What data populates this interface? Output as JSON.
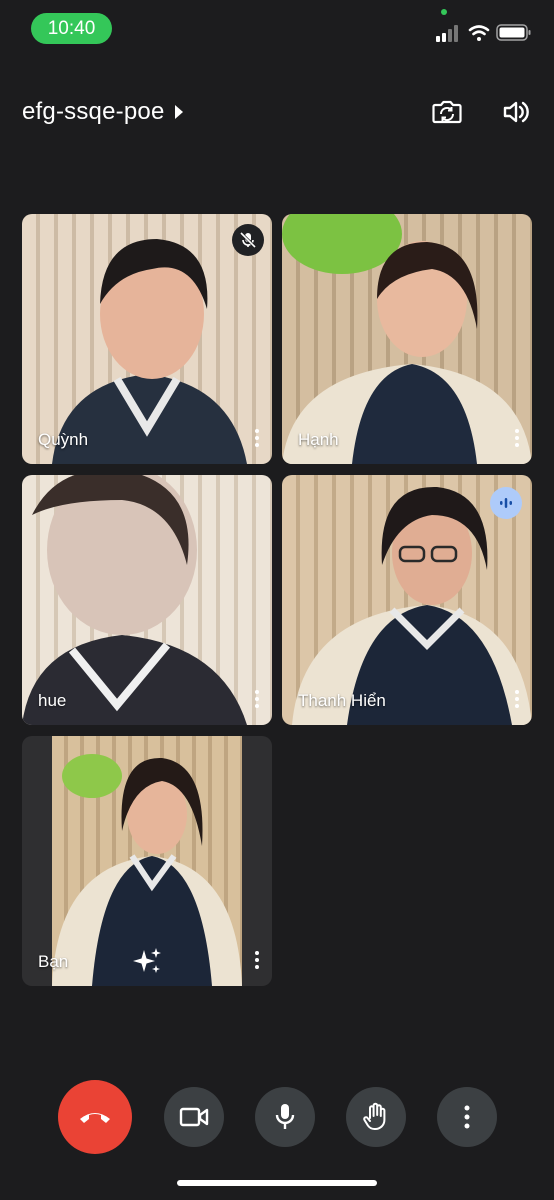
{
  "status_bar": {
    "time": "10:40"
  },
  "header": {
    "meeting_code": "efg-ssqe-poe"
  },
  "participants": [
    {
      "name": "Quỳnh",
      "state": "muted"
    },
    {
      "name": "Hạnh",
      "state": ""
    },
    {
      "name": "hue",
      "state": ""
    },
    {
      "name": "Thanh Hiển",
      "state": "speaking"
    },
    {
      "name": "Bạn",
      "state": "self"
    }
  ],
  "colors": {
    "background": "#1c1c1e",
    "status_pill": "#34c759",
    "hangup": "#ea4335",
    "control": "#3c4043",
    "speaking_badge": "#aecbfa"
  },
  "icons": {
    "header": [
      "switch-camera-icon",
      "speaker-icon"
    ],
    "controls": [
      "end-call-icon",
      "camera-icon",
      "microphone-icon",
      "raise-hand-icon",
      "more-options-icon"
    ]
  }
}
